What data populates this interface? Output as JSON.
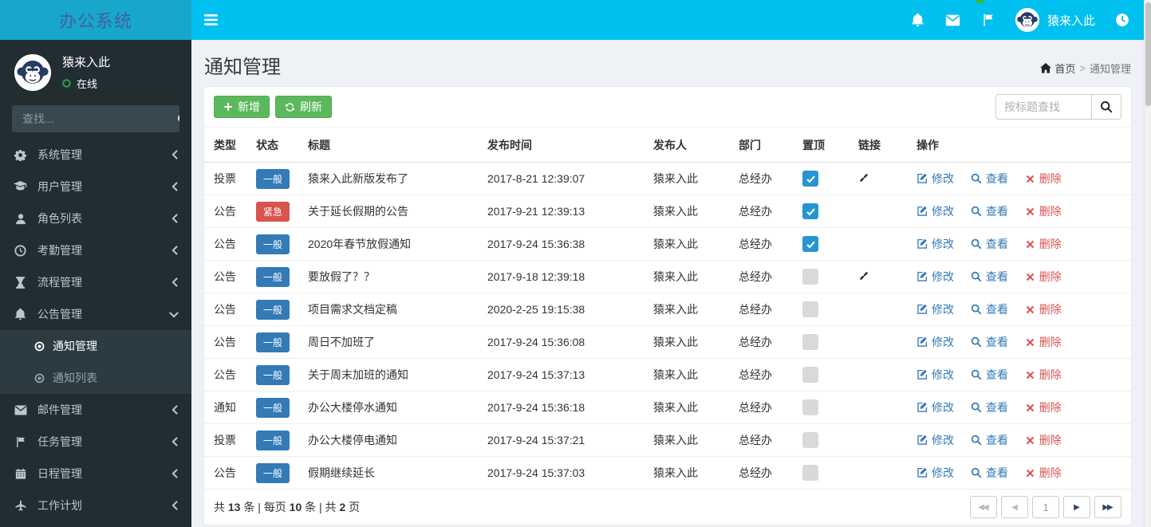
{
  "app_title": "办公系统",
  "theme": {
    "navbar_bg": "#00c0ef",
    "logo_bg": "#17a7ca",
    "sidebar_bg": "#222d32",
    "submenu_bg": "#2c3b41",
    "button_green": "#5cb85c",
    "label_primary_blue": "#337ab7",
    "label_danger_red": "#d9534f",
    "checkbox_checked_blue": "#2795d2",
    "online_green": "#2f9e44",
    "action_link_blue": "#337ab7",
    "action_delete_red": "#d9534f"
  },
  "topbar": {
    "user_name": "猿来入此",
    "icons": [
      "bars-icon",
      "bell-icon",
      "envelope-icon",
      "flag-icon",
      "monkey-avatar",
      "clock-icon"
    ]
  },
  "sidebar": {
    "user": {
      "name": "猿来入此",
      "status": "在线"
    },
    "search_placeholder": "查找...",
    "items": [
      {
        "label": "系统管理",
        "icon": "gear-icon"
      },
      {
        "label": "用户管理",
        "icon": "graduation-cap-icon"
      },
      {
        "label": "角色列表",
        "icon": "user-icon"
      },
      {
        "label": "考勤管理",
        "icon": "clock-icon"
      },
      {
        "label": "流程管理",
        "icon": "hourglass-icon"
      },
      {
        "label": "公告管理",
        "icon": "bell-icon",
        "expanded": true
      },
      {
        "label": "邮件管理",
        "icon": "envelope-icon"
      },
      {
        "label": "任务管理",
        "icon": "flag-icon"
      },
      {
        "label": "日程管理",
        "icon": "calendar-icon"
      },
      {
        "label": "工作计划",
        "icon": "plane-icon"
      }
    ],
    "submenu": [
      {
        "label": "通知管理",
        "icon": "dot-circle-icon",
        "active": true
      },
      {
        "label": "通知列表",
        "icon": "dot-circle-icon",
        "active": false
      }
    ]
  },
  "page_title": "通知管理",
  "breadcrumb": {
    "home": "首页",
    "separator": ">",
    "current": "通知管理"
  },
  "toolbar": {
    "add": "新增",
    "refresh": "刷新",
    "search_placeholder": "按标题查找"
  },
  "table": {
    "headers": [
      "类型",
      "状态",
      "标题",
      "发布时间",
      "发布人",
      "部门",
      "置顶",
      "链接",
      "操作"
    ],
    "actions": {
      "edit": "修改",
      "view": "查看",
      "delete": "删除"
    },
    "rows": [
      {
        "type": "投票",
        "status": "一般",
        "urgent": false,
        "title": "猿来入此新版发布了",
        "time": "2017-8-21 12:39:07",
        "publisher": "猿来入此",
        "dept": "总经办",
        "pinned": true,
        "link": true
      },
      {
        "type": "公告",
        "status": "紧急",
        "urgent": true,
        "title": "关于延长假期的公告",
        "time": "2017-9-21 12:39:13",
        "publisher": "猿来入此",
        "dept": "总经办",
        "pinned": true,
        "link": false
      },
      {
        "type": "公告",
        "status": "一般",
        "urgent": false,
        "title": "2020年春节放假通知",
        "time": "2017-9-24 15:36:38",
        "publisher": "猿来入此",
        "dept": "总经办",
        "pinned": true,
        "link": false
      },
      {
        "type": "公告",
        "status": "一般",
        "urgent": false,
        "title": "要放假了？？",
        "time": "2017-9-18 12:39:18",
        "publisher": "猿来入此",
        "dept": "总经办",
        "pinned": false,
        "link": true
      },
      {
        "type": "公告",
        "status": "一般",
        "urgent": false,
        "title": "项目需求文档定稿",
        "time": "2020-2-25 19:15:38",
        "publisher": "猿来入此",
        "dept": "总经办",
        "pinned": false,
        "link": false
      },
      {
        "type": "公告",
        "status": "一般",
        "urgent": false,
        "title": "周日不加班了",
        "time": "2017-9-24 15:36:08",
        "publisher": "猿来入此",
        "dept": "总经办",
        "pinned": false,
        "link": false
      },
      {
        "type": "公告",
        "status": "一般",
        "urgent": false,
        "title": "关于周末加班的通知",
        "time": "2017-9-24 15:37:13",
        "publisher": "猿来入此",
        "dept": "总经办",
        "pinned": false,
        "link": false
      },
      {
        "type": "通知",
        "status": "一般",
        "urgent": false,
        "title": "办公大楼停水通知",
        "time": "2017-9-24 15:36:18",
        "publisher": "猿来入此",
        "dept": "总经办",
        "pinned": false,
        "link": false
      },
      {
        "type": "投票",
        "status": "一般",
        "urgent": false,
        "title": "办公大楼停电通知",
        "time": "2017-9-24 15:37:21",
        "publisher": "猿来入此",
        "dept": "总经办",
        "pinned": false,
        "link": false
      },
      {
        "type": "公告",
        "status": "一般",
        "urgent": false,
        "title": "假期继续延长",
        "time": "2017-9-24 15:37:03",
        "publisher": "猿来入此",
        "dept": "总经办",
        "pinned": false,
        "link": false
      }
    ]
  },
  "pagination": {
    "summary": {
      "t1": "共 ",
      "n1": "13",
      "t2": " 条 | 每页 ",
      "n2": "10",
      "t3": " 条 | 共 ",
      "n3": "2",
      "t4": " 页"
    },
    "page": "1",
    "first_icon": "◀◀",
    "prev_icon": "◀",
    "next_icon": "▶",
    "last_icon": "▶▶"
  }
}
